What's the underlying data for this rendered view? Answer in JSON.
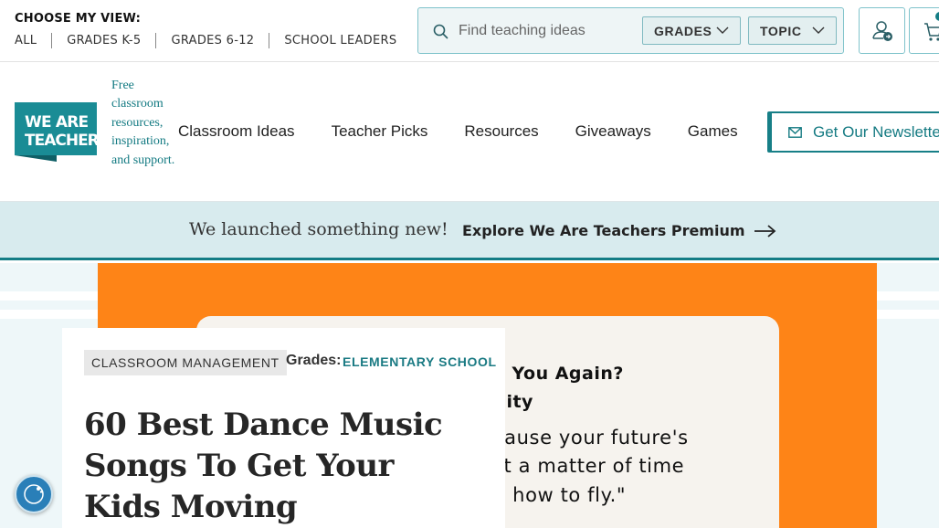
{
  "view_selector": {
    "label": "CHOOSE MY VIEW:",
    "options": [
      "ALL",
      "GRADES K-5",
      "GRADES 6-12",
      "SCHOOL LEADERS"
    ]
  },
  "search": {
    "placeholder": "Find teaching ideas",
    "grades_label": "GRADES",
    "topic_label": "TOPIC"
  },
  "header": {
    "logo_text": [
      "WE ARE",
      "TEACHERS"
    ],
    "tagline": "Free classroom resources, inspiration, and support.",
    "nav": [
      "Classroom Ideas",
      "Teacher Picks",
      "Resources",
      "Giveaways",
      "Games"
    ],
    "newsletter_label": "Get Our Newsletter"
  },
  "promo": {
    "text": "We launched something new!",
    "link": "Explore We Are Teachers Premium"
  },
  "hero": {
    "quote_lines": [
      "e You Again?",
      "City",
      "cause your future's",
      "st a matter of time",
      "n how to fly.\""
    ]
  },
  "article": {
    "category": "CLASSROOM MANAGEMENT",
    "grades_label": "Grades:",
    "grades_value": "ELEMENTARY SCHOOL",
    "title": "60 Best Dance Music Songs To Get Your Kids Moving"
  },
  "colors": {
    "brand_teal": "#147d85",
    "hero_orange": "#fe8417",
    "promo_bg": "#d8ebee",
    "accessibility_blue": "#2a7fb8"
  }
}
